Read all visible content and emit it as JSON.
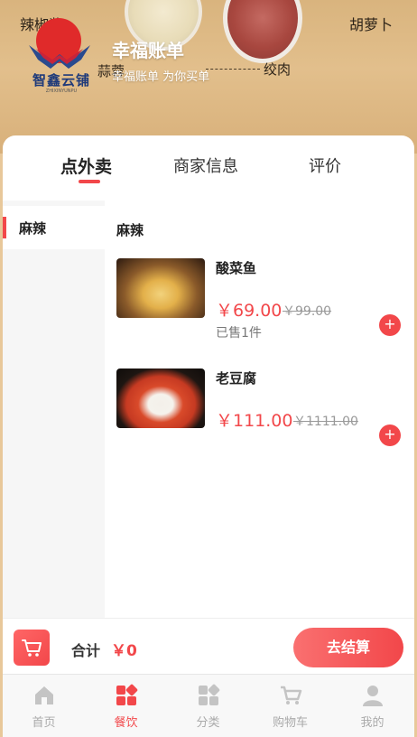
{
  "banner": {
    "bg_words": [
      "辣椒酱",
      "胡萝卜",
      "蒜蓉",
      "绞肉"
    ],
    "logo_text": "智鑫云铺",
    "logo_subtext": "ZHIXINYUNPU",
    "shop_name": "幸福账单",
    "shop_slogan": "幸福账单 为你买单"
  },
  "tabs": [
    {
      "label": "点外卖",
      "active": true
    },
    {
      "label": "商家信息",
      "active": false
    },
    {
      "label": "评价",
      "active": false
    }
  ],
  "sidebar": {
    "items": [
      {
        "label": "麻辣",
        "active": true
      }
    ]
  },
  "menu": {
    "category_title": "麻辣",
    "dishes": [
      {
        "name": "酸菜鱼",
        "price": "￥69.00",
        "original_price": "￥99.00",
        "sold": "已售1件"
      },
      {
        "name": "老豆腐",
        "price": "￥111.00",
        "original_price": "￥1111.00",
        "sold": ""
      }
    ],
    "add_label": "+"
  },
  "cart": {
    "total_label": "合计",
    "total_value": "￥0",
    "checkout_label": "去结算"
  },
  "tabbar": [
    {
      "label": "首页",
      "icon": "home-icon",
      "active": false
    },
    {
      "label": "餐饮",
      "icon": "dining-icon",
      "active": true
    },
    {
      "label": "分类",
      "icon": "category-icon",
      "active": false
    },
    {
      "label": "购物车",
      "icon": "cart-icon",
      "active": false
    },
    {
      "label": "我的",
      "icon": "user-icon",
      "active": false
    }
  ],
  "colors": {
    "accent": "#f2474a",
    "banner": "#d9b47e",
    "inactive": "#aaaaaa"
  }
}
